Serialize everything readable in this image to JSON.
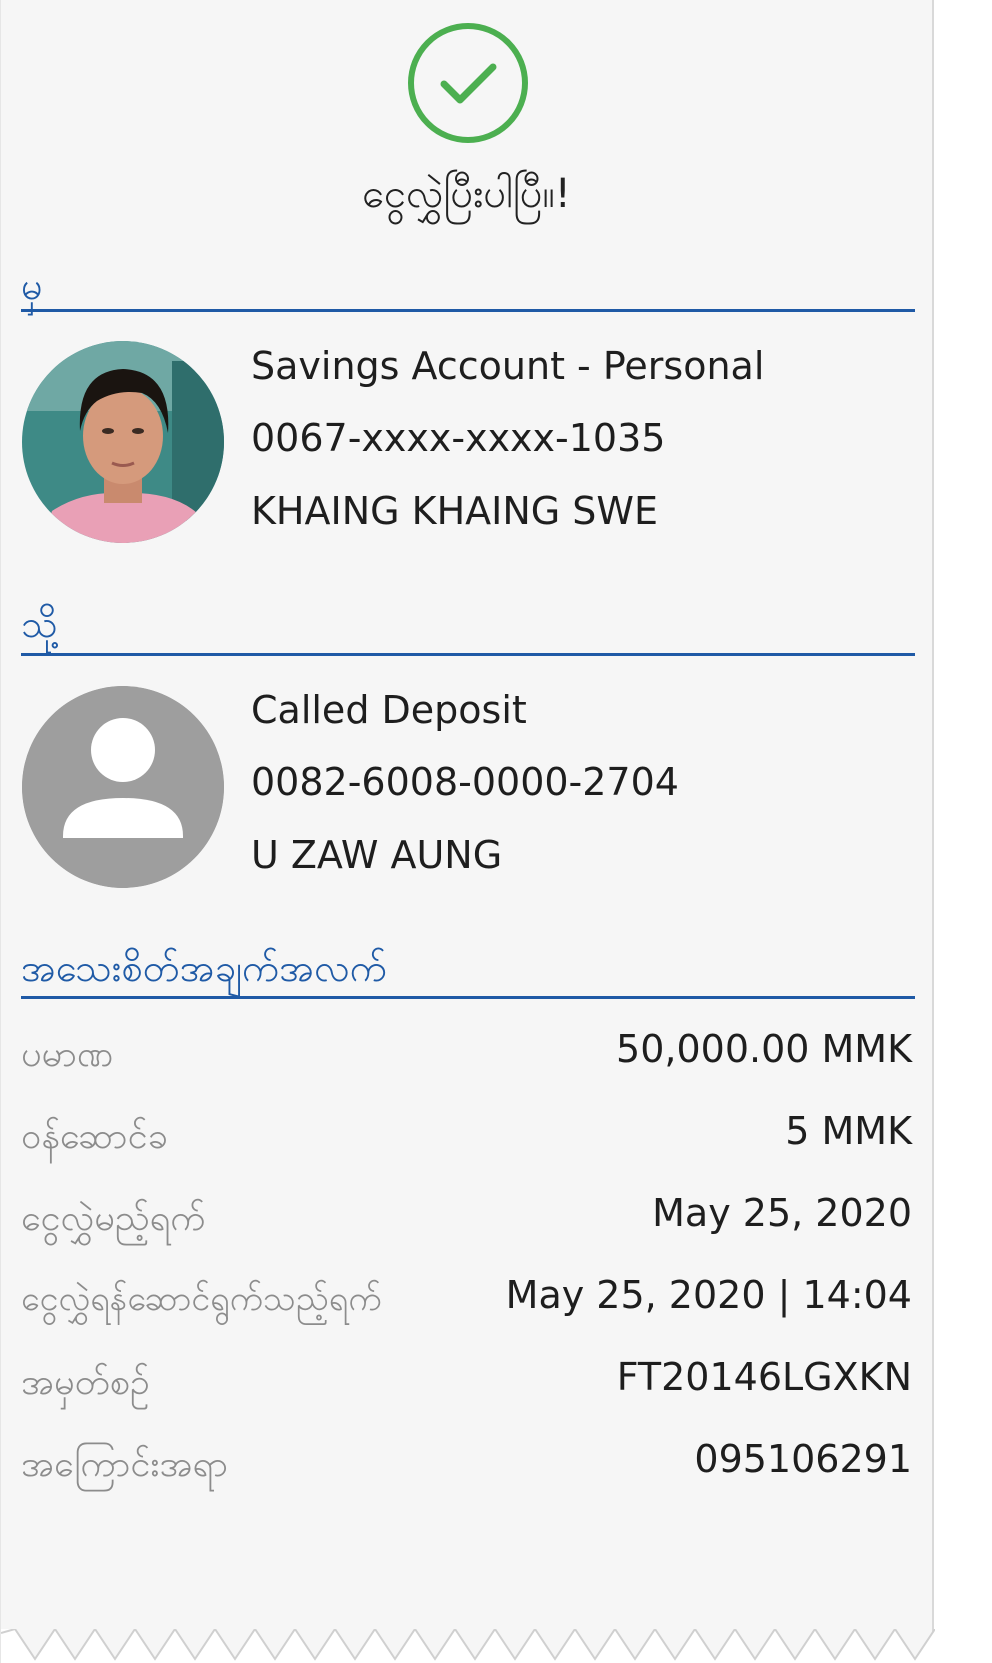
{
  "status": {
    "message": "ငွေလွှဲပြီးပါပြီ။!",
    "icon": "check-circle-icon",
    "color": "#4caf50"
  },
  "from": {
    "label": "မှ",
    "account_type": "Savings Account - Personal",
    "account_number": "0067-xxxx-xxxx-1035",
    "account_name": "KHAING KHAING SWE",
    "avatar": "profile-photo"
  },
  "to": {
    "label": "သို့",
    "account_type": "Called Deposit",
    "account_number": "0082-6008-0000-2704",
    "account_name": "U ZAW AUNG",
    "avatar": "person-placeholder-icon"
  },
  "details": {
    "label": "အသေးစိတ်အချက်အလက်",
    "rows": [
      {
        "label": "ပမာဏ",
        "value": "50,000.00 MMK"
      },
      {
        "label": "ဝန်ဆောင်ခ",
        "value": "5 MMK"
      },
      {
        "label": "ငွေလွှဲမည့်ရက်",
        "value": "May 25, 2020"
      },
      {
        "label": "ငွေလွှဲရန်ဆောင်ရွက်သည့်ရက်",
        "value": "May 25, 2020 | 14:04"
      },
      {
        "label": "အမှတ်စဉ်",
        "value": "FT20146LGXKN"
      },
      {
        "label": "အကြောင်းအရာ",
        "value": "095106291"
      }
    ]
  },
  "colors": {
    "accent": "#1f5aa6",
    "success": "#4caf50",
    "label_gray": "#8c8c8c",
    "background": "#f6f6f6"
  }
}
